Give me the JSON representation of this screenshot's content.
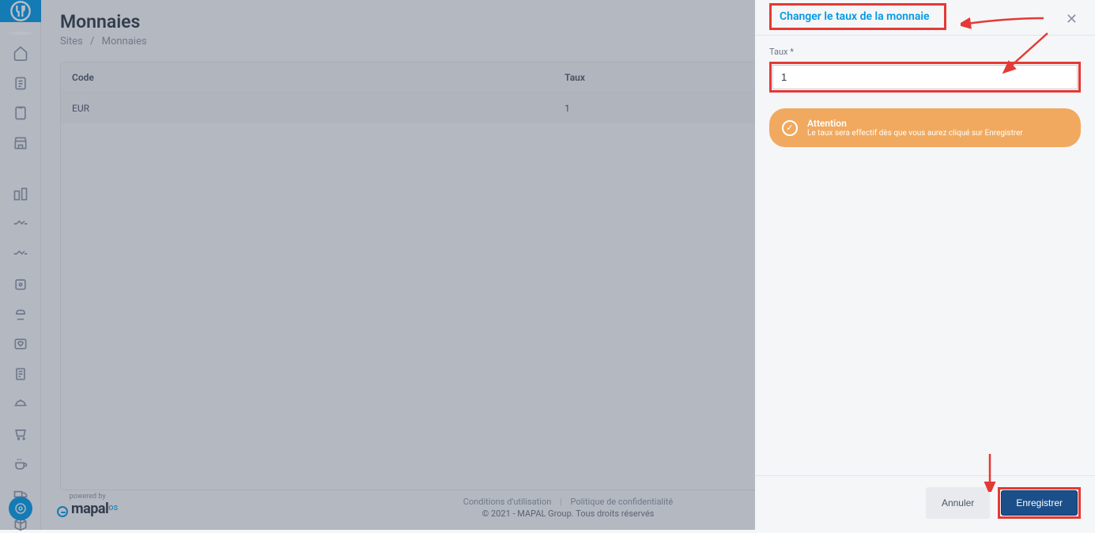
{
  "page": {
    "title": "Monnaies",
    "breadcrumb": {
      "root": "Sites",
      "current": "Monnaies"
    }
  },
  "table": {
    "headers": {
      "code": "Code",
      "rate": "Taux"
    },
    "rows": [
      {
        "code": "EUR",
        "rate": "1"
      }
    ]
  },
  "footer": {
    "terms": "Conditions d'utilisation",
    "privacy": "Politique de confidentialité",
    "copyright": "© 2021 - MAPAL Group. Tous droits réservés",
    "poweredby_label": "powered by",
    "brand": "mapal",
    "brand_suffix": "os"
  },
  "panel": {
    "title": "Changer le taux de la monnaie",
    "field_label": "Taux *",
    "input_value": "1",
    "alert_title": "Attention",
    "alert_msg": "Le taux sera effectif dès que vous aurez cliqué sur Enregistrer",
    "cancel": "Annuler",
    "save": "Enregistrer"
  },
  "colors": {
    "accent": "#0099e5",
    "highlight": "#e53935",
    "warn": "#f0a95e",
    "primary_btn": "#1a4f8a"
  }
}
